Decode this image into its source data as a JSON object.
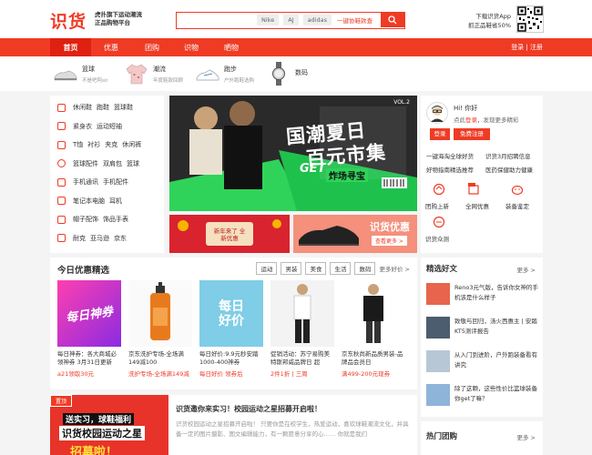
{
  "logo": "识货",
  "slogan": [
    "虎扑旗下运动潮流",
    "正品购物平台"
  ],
  "search": {
    "chips": [
      "Nike",
      "AJ",
      "adidas"
    ],
    "hint": "一键协鞋款查"
  },
  "app": [
    "下载识货App",
    "抓正品鞋省50%"
  ],
  "nav": {
    "items": [
      "首页",
      "优惠",
      "团购",
      "识物",
      "晒物"
    ],
    "login": "登录 | 注册"
  },
  "subcats": [
    {
      "name": "篮球",
      "desc": "不是吧阿sir"
    },
    {
      "name": "潮流",
      "desc": "年度鞋款回顾"
    },
    {
      "name": "跑步",
      "desc": "户外跑鞋选购"
    },
    {
      "name": "数码",
      "desc": ""
    }
  ],
  "side": [
    [
      "休闲鞋",
      "跑鞋",
      "篮球鞋"
    ],
    [
      "紧身衣",
      "运动短袖"
    ],
    [
      "T恤",
      "衬衫",
      "夹克",
      "休闲裤"
    ],
    [
      "篮球配件",
      "双肩包",
      "篮球"
    ],
    [
      "手机通讯",
      "手机配件"
    ],
    [
      "笔记本电脑",
      "耳机"
    ],
    [
      "帽子配饰",
      "饰品手表"
    ],
    [
      "耐克",
      "亚马逊",
      "京东"
    ]
  ],
  "banner": {
    "title": "国潮夏日",
    "title2": "百元市集",
    "get": "GET",
    "sub": "炸场寻宝",
    "vol": "VOL.2"
  },
  "ban_small": {
    "left": "新年来了 全新优惠",
    "right": "识货优惠",
    "right_btn": "查看更多 >"
  },
  "user": {
    "greet": "Hi! 你好",
    "prompt_a": "点此",
    "prompt_b": "登录",
    "prompt_c": "，发现更多精彩",
    "login": "登录",
    "register": "免费注册",
    "links": [
      [
        "一键海淘全球好货",
        "识货3月招聘信息"
      ],
      [
        "好物指南精选推荐",
        "医药保健助力健康"
      ]
    ],
    "icons": [
      "团购上新",
      "全网优惠",
      "装备鉴定",
      "识货众测"
    ]
  },
  "today": {
    "title": "今日优惠精选",
    "tags": [
      "运动",
      "男装",
      "美食",
      "生活",
      "数码"
    ],
    "more": "更多好价 >"
  },
  "cards": [
    {
      "title": "每日神券：各大商城必领神券 3月31日更新",
      "price": "a21领取30元",
      "img_text": "每日神券"
    },
    {
      "title": "京东洗护专场-全场满149减100",
      "price": "洗护专场-全场满149减",
      "img_text": ""
    },
    {
      "title": "每日好价:9.9元秒安踏1000-400神券",
      "price": "每日好价 领券后",
      "img_text": "每日好价"
    },
    {
      "title": "促销活动：苏宁易购美特斯邦威品牌日 超",
      "price": "2件1折 | 三周",
      "img_text": ""
    },
    {
      "title": "京东秋尚新品质男装-品牌品会员日",
      "price": "满499-200元现券",
      "img_text": ""
    }
  ],
  "news": {
    "tag": "置顶",
    "headline": "识货邀你来实习！校园运动之星招募开启啦！",
    "body": "识货校园运动之星招募开启啦！ 只要你是在校学生，热爱运动，喜欢球鞋潮流文化，并具备一定的图片摄影、图文编辑能力，有一颗愿意分享的心…… 你就是我们",
    "img_a": "送实习，球鞋福利",
    "img_b": "识货校园运动之星",
    "img_c": "招募啦！"
  },
  "rec": {
    "title": "精选好文",
    "more": "更多 >",
    "items": [
      "Reno3元气版，告诉你女神的手机该是什么样子",
      "致敬与回归，汤火西惠主 | 安踏KT5测评报告",
      "从入门到进阶，户外跑装备看有讲究",
      "除了这颗，这些性价比篮球装备你get了嘛？"
    ]
  },
  "hot": {
    "title": "热门团购",
    "more": "更多 >"
  },
  "colors": {
    "accent": "#ef3b24"
  }
}
